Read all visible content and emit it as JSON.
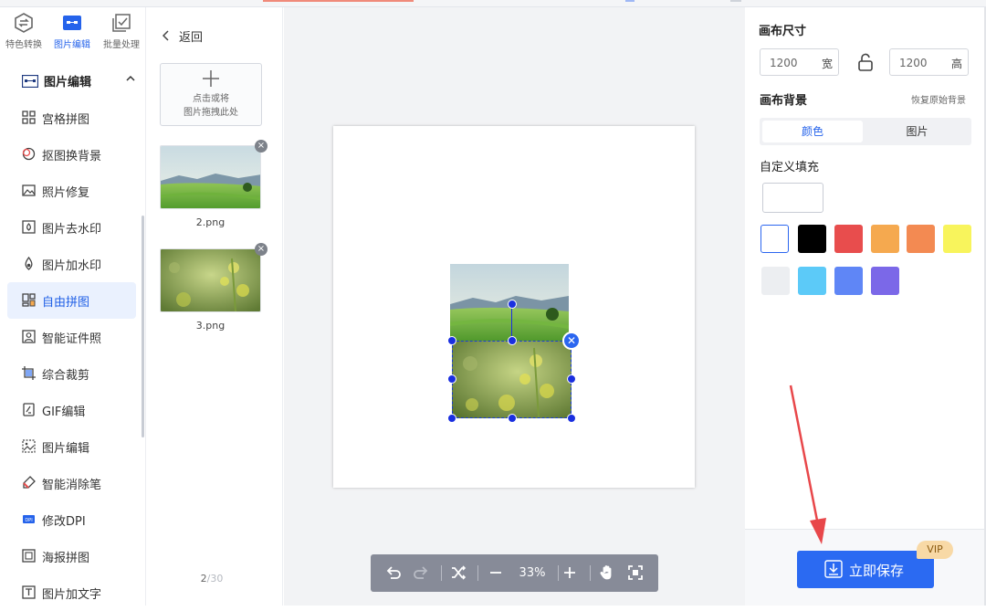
{
  "sidebar": {
    "top_tabs": [
      {
        "label": "特色转换",
        "icon": "convert-icon"
      },
      {
        "label": "图片编辑",
        "icon": "image-edit-icon"
      },
      {
        "label": "批量处理",
        "icon": "batch-icon"
      }
    ],
    "section_title": "图片编辑",
    "items": [
      {
        "label": "宫格拼图",
        "icon": "grid-icon"
      },
      {
        "label": "抠图换背景",
        "icon": "cutout-icon"
      },
      {
        "label": "照片修复",
        "icon": "photo-repair-icon"
      },
      {
        "label": "图片去水印",
        "icon": "remove-watermark-icon"
      },
      {
        "label": "图片加水印",
        "icon": "add-watermark-icon"
      },
      {
        "label": "自由拼图",
        "icon": "free-collage-icon"
      },
      {
        "label": "智能证件照",
        "icon": "id-photo-icon"
      },
      {
        "label": "综合裁剪",
        "icon": "crop-icon"
      },
      {
        "label": "GIF编辑",
        "icon": "gif-icon"
      },
      {
        "label": "图片编辑",
        "icon": "image-icon"
      },
      {
        "label": "智能消除笔",
        "icon": "eraser-icon"
      },
      {
        "label": "修改DPI",
        "icon": "dpi-icon"
      },
      {
        "label": "海报拼图",
        "icon": "poster-icon"
      },
      {
        "label": "图片加文字",
        "icon": "add-text-icon"
      }
    ],
    "active_item": "自由拼图"
  },
  "files": {
    "back_label": "返回",
    "drop_line1": "点击或将",
    "drop_line2": "图片拖拽此处",
    "thumbs": [
      {
        "name": "2.png"
      },
      {
        "name": "3.png"
      }
    ],
    "page_current": "2",
    "page_total": "/30"
  },
  "toolbar": {
    "zoom": "33%"
  },
  "right": {
    "canvas_size_title": "画布尺寸",
    "width_value": "1200",
    "width_unit": "宽",
    "height_value": "1200",
    "height_unit": "高",
    "bg_title": "画布背景",
    "restore_label": "恢复原始背景",
    "tab_color": "颜色",
    "tab_image": "图片",
    "custom_fill": "自定义填充",
    "swatches": [
      "#ffffff",
      "#000000",
      "#e84d4d",
      "#f5a94f",
      "#f38a52",
      "#f8f45c",
      "#eceef1",
      "#5ccaf8",
      "#5f86f6",
      "#7b68e8"
    ],
    "save_label": "立即保存",
    "vip_label": "VIP"
  },
  "colors": {
    "accent": "#2b6af2",
    "active_bg": "#eaf1fe",
    "annotation_arrow": "#e8474a"
  }
}
